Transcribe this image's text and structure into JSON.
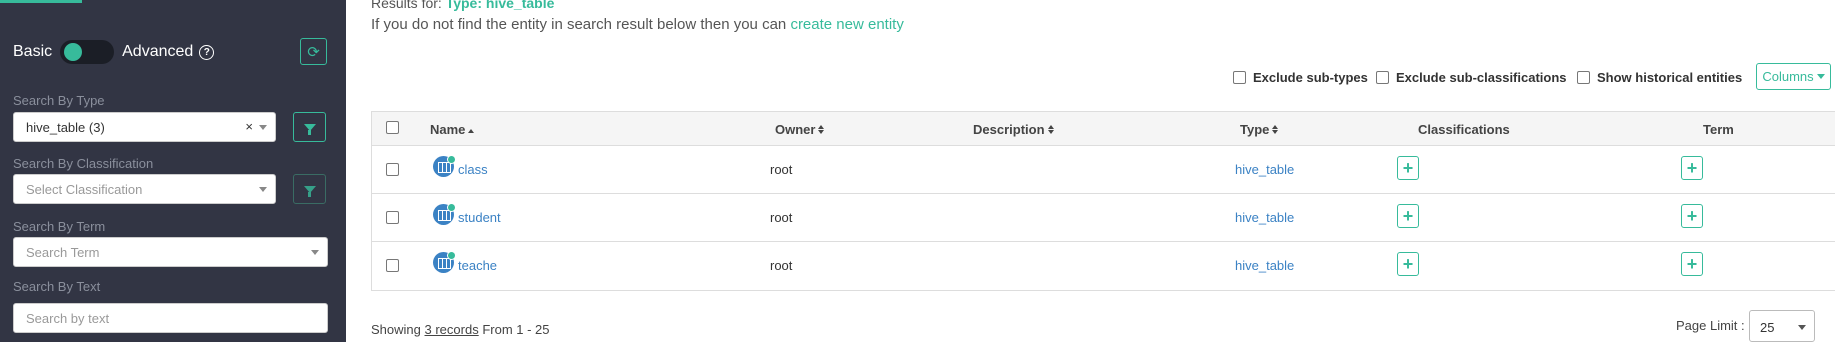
{
  "sidebar": {
    "mode": {
      "basic": "Basic",
      "advanced": "Advanced",
      "help_icon": "?"
    },
    "type_label": "Search By Type",
    "type_value": "hive_table (3)",
    "type_clear": "×",
    "classification_label": "Search By Classification",
    "classification_placeholder": "Select Classification",
    "term_label": "Search By Term",
    "term_placeholder": "Search Term",
    "text_label": "Search By Text",
    "text_placeholder": "Search by text"
  },
  "main": {
    "results_for": "Results for:",
    "results_type": "Type: hive_table",
    "hint_text": "If you do not find the entity in search result below then you can",
    "hint_link": "create new entity",
    "options": {
      "exclude_subtypes": "Exclude sub-types",
      "exclude_subclass": "Exclude sub-classifications",
      "show_historical": "Show historical entities"
    },
    "columns_button": "Columns",
    "table": {
      "headers": {
        "name": "Name",
        "owner": "Owner",
        "description": "Description",
        "type": "Type",
        "classifications": "Classifications",
        "term": "Term"
      },
      "rows": [
        {
          "name": "class",
          "owner": "root",
          "type": "hive_table"
        },
        {
          "name": "student",
          "owner": "root",
          "type": "hive_table"
        },
        {
          "name": "teache",
          "owner": "root",
          "type": "hive_table"
        }
      ],
      "add_symbol": "+"
    },
    "footer": {
      "showing": "Showing",
      "records": "3 records",
      "range": "From 1 - 25",
      "page_limit_label": "Page Limit :",
      "page_limit_value": "25"
    }
  },
  "colors": {
    "accent": "#37bb9b",
    "sidebar_bg": "#323544",
    "link": "#3b82c4"
  },
  "icons": [
    "help-icon",
    "refresh-icon",
    "filter-icon",
    "sort-icon",
    "table-entity-icon",
    "plus-icon",
    "caret-down-icon"
  ]
}
